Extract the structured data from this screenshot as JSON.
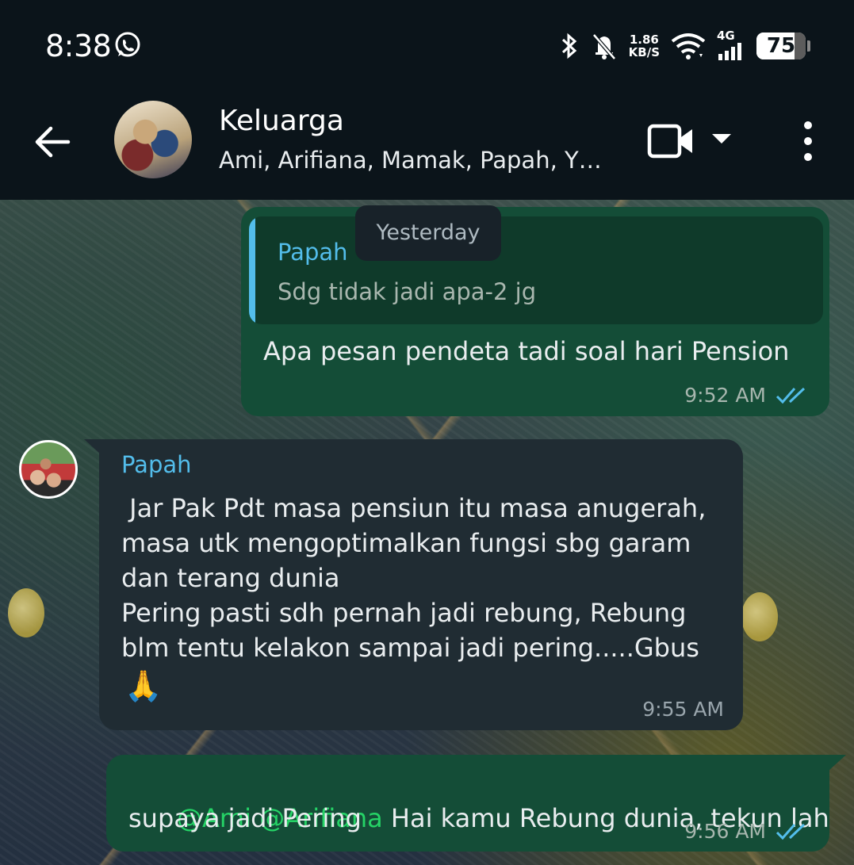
{
  "status_bar": {
    "time": "8:38",
    "network_speed_value": "1.86",
    "network_speed_unit": "KB/S",
    "network_type": "4G",
    "battery": "75",
    "icons": [
      "whatsapp-icon",
      "bluetooth-icon",
      "bell-muted-icon",
      "wifi-icon",
      "signal-icon",
      "battery-icon"
    ]
  },
  "header": {
    "title": "Keluarga",
    "subtitle": "Ami, Arifiana, Mamak, Papah, Y…"
  },
  "date_chip": "Yesterday",
  "messages": [
    {
      "direction": "outgoing",
      "reply_to": {
        "sender": "Papah",
        "text": "Sdg tidak jadi apa-2 jg"
      },
      "text": "Apa pesan pendeta tadi soal hari Pension",
      "time": "9:52 AM",
      "status": "read"
    },
    {
      "direction": "incoming",
      "sender": "Papah",
      "lines": [
        " Jar Pak Pdt masa pensiun itu masa anugerah,",
        "masa utk mengoptimalkan fungsi sbg garam",
        "dan terang dunia",
        "Pering pasti sdh pernah jadi rebung, Rebung",
        "blm tentu kelakon sampai jadi pering.....Gbus"
      ],
      "emoji": "🙏",
      "time": "9:55 AM"
    },
    {
      "direction": "outgoing",
      "mentions": [
        "@Ami",
        "@Arifiana"
      ],
      "text_line1": " Hai kamu Rebung dunia, tekun lah",
      "text_line2": "supaya jadi Pering",
      "time": "9:56 AM",
      "status": "read"
    }
  ],
  "colors": {
    "outgoing_bubble": "#144d37",
    "incoming_bubble": "#202c33",
    "accent_blue": "#53bdeb",
    "mention_green": "#25d366"
  }
}
